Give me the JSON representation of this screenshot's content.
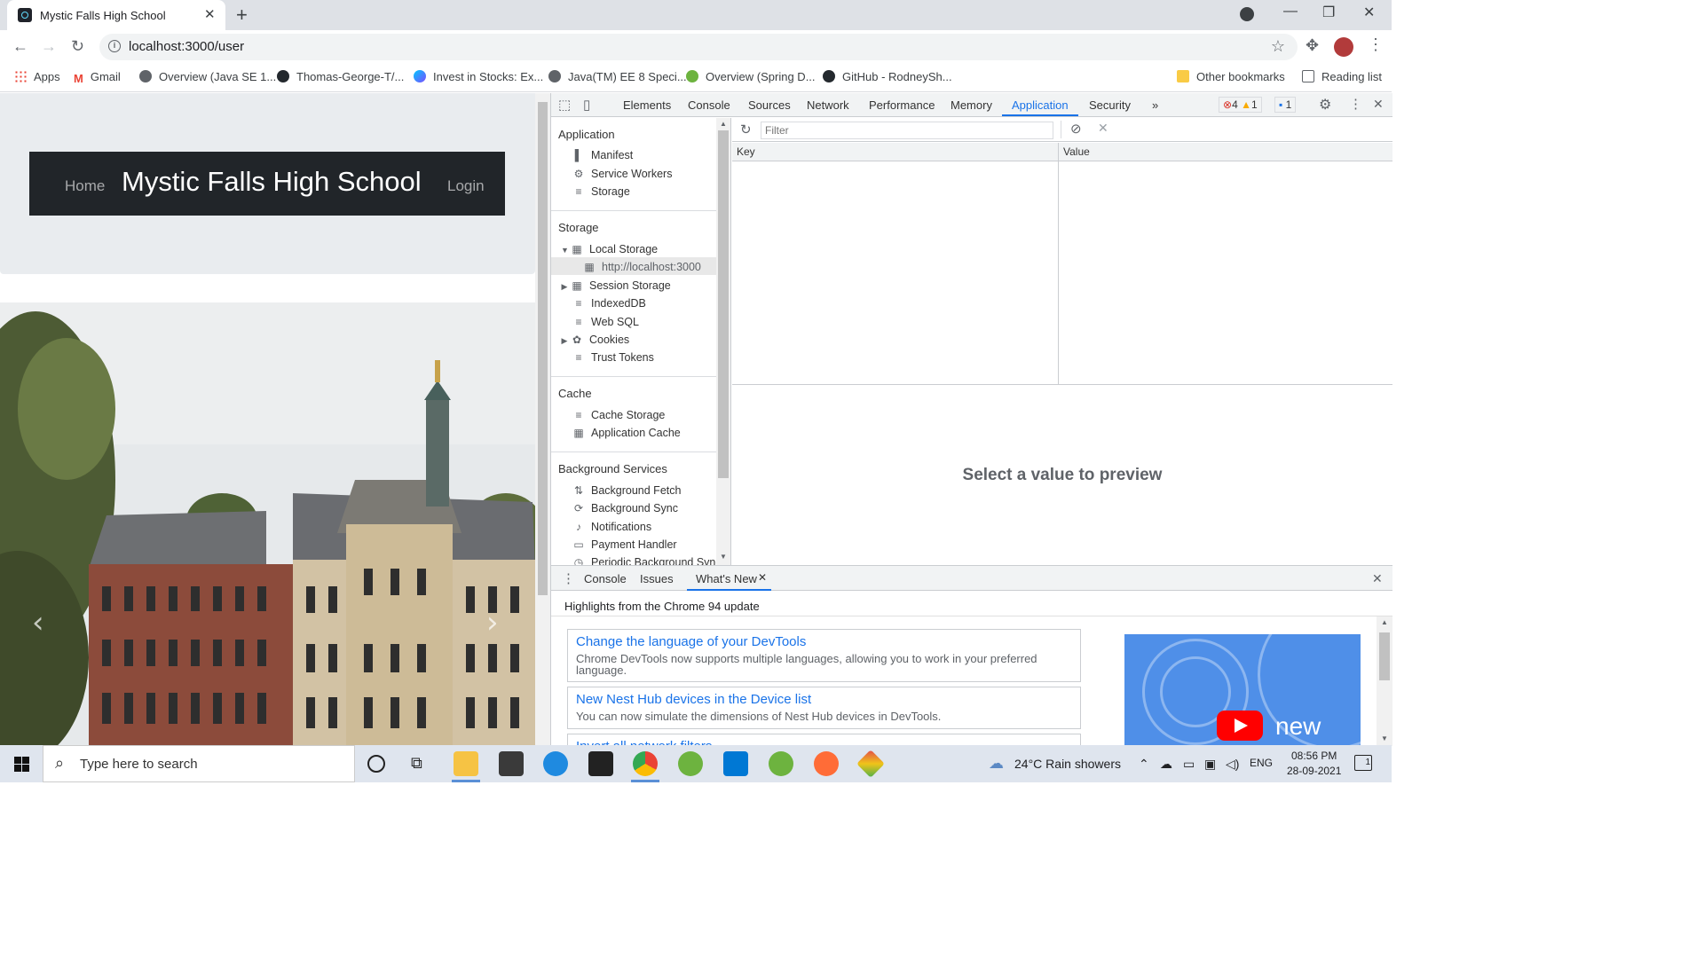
{
  "browser": {
    "tab_title": "Mystic Falls High School",
    "new_tab": "+",
    "url": "localhost:3000/user",
    "bookmarks": [
      {
        "label": "Apps",
        "color": "#ea4335"
      },
      {
        "label": "Gmail",
        "color": "#ea4335"
      },
      {
        "label": "Overview (Java SE 1...",
        "color": "#5f6368"
      },
      {
        "label": "Thomas-George-T/...",
        "color": "#24292e"
      },
      {
        "label": "Invest in Stocks: Ex...",
        "color": "#7c4dff"
      },
      {
        "label": "Java(TM) EE 8 Speci...",
        "color": "#5f6368"
      },
      {
        "label": "Overview (Spring D...",
        "color": "#6db33f"
      },
      {
        "label": "GitHub - RodneySh...",
        "color": "#24292e"
      }
    ],
    "other_bookmarks": "Other bookmarks",
    "reading_list": "Reading list"
  },
  "site": {
    "nav_home": "Home",
    "brand": "Mystic Falls High School",
    "nav_login": "Login"
  },
  "devtools": {
    "tabs": [
      "Elements",
      "Console",
      "Sources",
      "Network",
      "Performance",
      "Memory",
      "Application",
      "Security"
    ],
    "selected_tab": "Application",
    "errors": "4",
    "warnings": "1",
    "messages": "1",
    "sidebar": {
      "application_header": "Application",
      "application_items": [
        "Manifest",
        "Service Workers",
        "Storage"
      ],
      "storage_header": "Storage",
      "storage_items": [
        "Local Storage",
        "http://localhost:3000",
        "Session Storage",
        "IndexedDB",
        "Web SQL",
        "Cookies",
        "Trust Tokens"
      ],
      "cache_header": "Cache",
      "cache_items": [
        "Cache Storage",
        "Application Cache"
      ],
      "bg_header": "Background Services",
      "bg_items": [
        "Background Fetch",
        "Background Sync",
        "Notifications",
        "Payment Handler",
        "Periodic Background Sync"
      ]
    },
    "filter_placeholder": "Filter",
    "columns": [
      "Key",
      "Value"
    ],
    "preview_text": "Select a value to preview",
    "drawer": {
      "tabs": [
        "Console",
        "Issues",
        "What's New"
      ],
      "highlights": "Highlights from the Chrome 94 update",
      "cards": [
        {
          "title": "Change the language of your DevTools",
          "desc": "Chrome DevTools now supports multiple languages, allowing you to work in your preferred language."
        },
        {
          "title": "New Nest Hub devices in the Device list",
          "desc": "You can now simulate the dimensions of Nest Hub devices in DevTools."
        },
        {
          "title": "Invert all network filters",
          "desc": ""
        }
      ],
      "promo_text": "new"
    }
  },
  "taskbar": {
    "search_placeholder": "Type here to search",
    "weather": "24°C  Rain showers",
    "lang": "ENG",
    "time": "08:56 PM",
    "date": "28-09-2021",
    "notifications": "1"
  }
}
